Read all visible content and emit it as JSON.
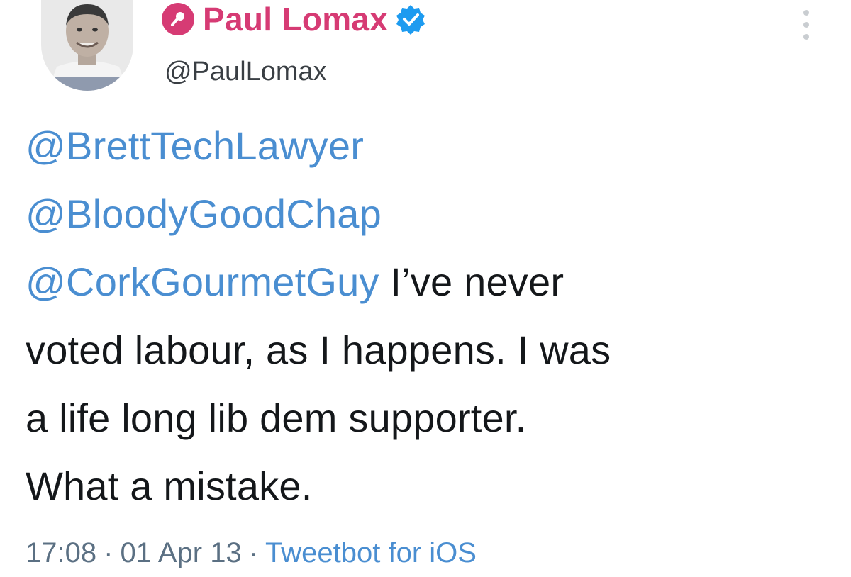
{
  "author": {
    "display_name": "Paul Lomax",
    "handle": "@PaulLomax",
    "role_icon": "microphone-icon",
    "verified_icon": "verified-badge-icon",
    "name_color": "#d63b74",
    "verified_color": "#1d9bf0"
  },
  "menu_icon": "more-vertical-icon",
  "body": {
    "mention_1": "@BrettTechLawyer",
    "mention_2": "@BloodyGoodChap",
    "mention_3": "@CorkGourmetGuy",
    "text_after_mentions": " I’ve never",
    "line_4": "voted labour, as I happens. I was",
    "line_5": "a life long lib dem supporter.",
    "line_6": "What a mistake."
  },
  "meta": {
    "time": "17:08",
    "separator": "·",
    "date": "01 Apr 13",
    "source": "Tweetbot for iOS"
  },
  "colors": {
    "mention": "#4a8ed1",
    "text": "#14171a",
    "meta": "#5b7083"
  }
}
